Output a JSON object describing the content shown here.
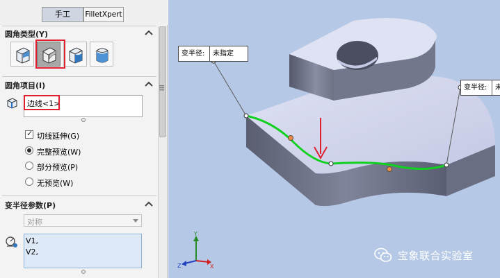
{
  "tabs": {
    "manual": "手工",
    "filletxpert": "FilletXpert"
  },
  "fillet_type": {
    "title": "圆角类型(Y)",
    "options": [
      "constant-size",
      "variable-size",
      "face",
      "full-round"
    ],
    "selected_index": 1
  },
  "fillet_items": {
    "title": "圆角项目(I)",
    "edges_value": "边线<1>"
  },
  "options": {
    "tangent_propagation": {
      "label": "切线延伸(G)",
      "checked": true
    },
    "preview": [
      {
        "label": "完整预览(W)",
        "selected": true
      },
      {
        "label": "部分预览(P)",
        "selected": false
      },
      {
        "label": "无预览(W)",
        "selected": false
      }
    ]
  },
  "variable_params": {
    "title": "变半径参数(P)",
    "select_value": "对称",
    "vertices": [
      "V1,",
      "V2,"
    ]
  },
  "viewport": {
    "callout_left": {
      "key": "变半径:",
      "value": "未指定"
    },
    "callout_right": {
      "key": "变半径:",
      "value": "未"
    },
    "triad_labels": {
      "y": "Y",
      "x": "X",
      "z": "Z"
    },
    "watermark": "宝象联合实验室"
  },
  "colors": {
    "accent_red": "#e0202e",
    "edge_green": "#10d020",
    "viewport_bg": "#b5c9e6"
  }
}
